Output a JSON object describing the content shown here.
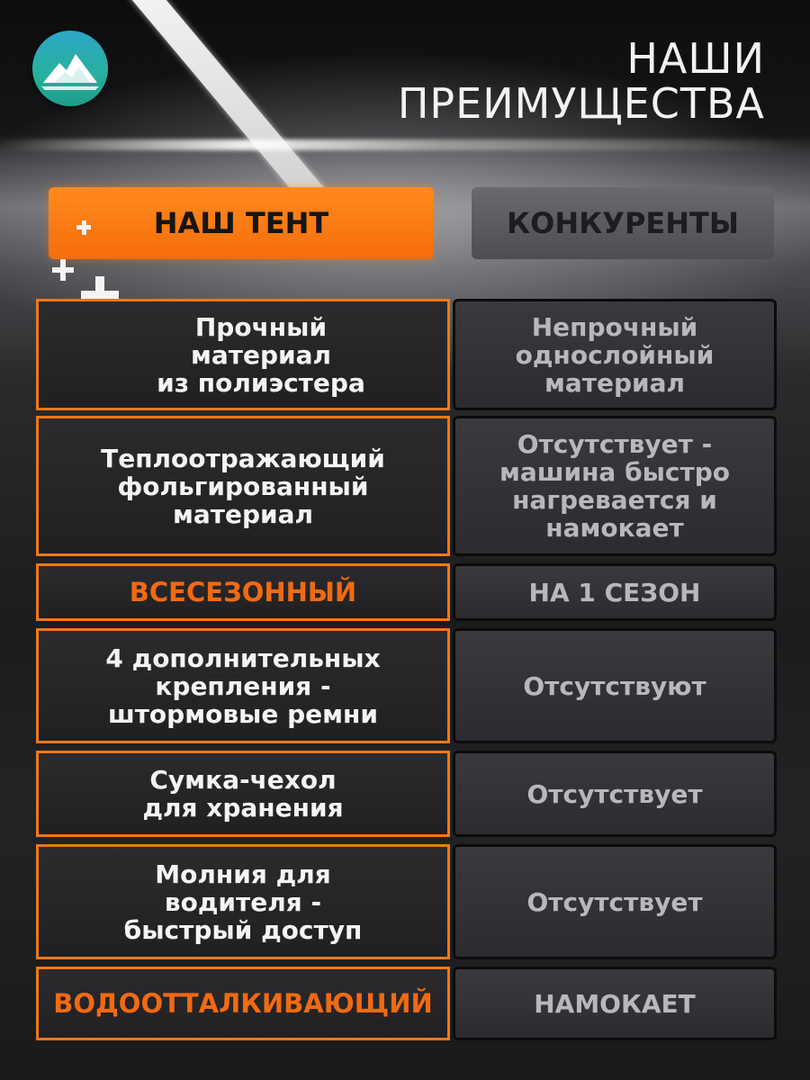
{
  "header": {
    "title_line1": "НАШИ",
    "title_line2": "ПРЕИМУЩЕСТВА",
    "logo_icon": "mountain-logo-icon"
  },
  "tabs": {
    "ours": "НАШ ТЕНТ",
    "competitors": "КОНКУРЕНТЫ"
  },
  "colors": {
    "accent": "#f26a12",
    "tab_orange": "#f57b15",
    "logo_teal": "#27b19d"
  },
  "rows": [
    {
      "ours": "Прочный\nматериал\nиз полиэстера",
      "competitors": "Непрочный\nоднослойный\nматериал",
      "accent": false
    },
    {
      "ours": "Теплоотражающий\nфольгированный\nматериал",
      "competitors": "Отсутствует -\nмашина быстро\nнагревается и\nнамокает",
      "accent": false
    },
    {
      "ours": "ВСЕСЕЗОННЫЙ",
      "competitors": "НА 1 СЕЗОН",
      "accent": true
    },
    {
      "ours": "4 дополнительных\nкрепления -\nштормовые ремни",
      "competitors": "Отсутствуют",
      "accent": false
    },
    {
      "ours": "Сумка-чехол\nдля хранения",
      "competitors": "Отсутствует",
      "accent": false
    },
    {
      "ours": "Молния для\nводителя -\nбыстрый доступ",
      "competitors": "Отсутствует",
      "accent": false
    },
    {
      "ours": "ВОДООТТАЛКИВАЮЩИЙ",
      "competitors": "НАМОКАЕТ",
      "accent": true
    }
  ]
}
